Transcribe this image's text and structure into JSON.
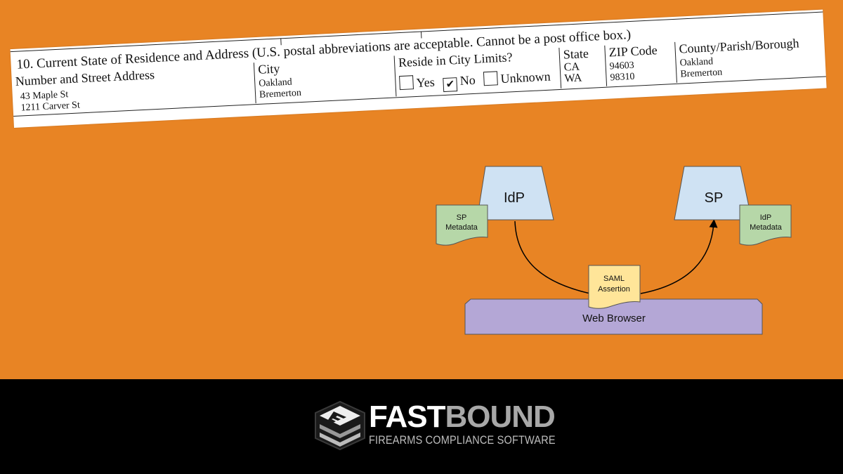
{
  "form": {
    "title": "10.  Current State of Residence and Address  (U.S. postal abbreviations are acceptable.  Cannot be a post office box.)",
    "columns": {
      "street": {
        "header": "Number and Street Address",
        "values": [
          "43 Maple St",
          "1211 Carver St"
        ]
      },
      "city": {
        "header": "City",
        "values": [
          "Oakland",
          "Bremerton"
        ]
      },
      "city_limits": {
        "header": "Reside in City Limits?",
        "options": [
          {
            "label": "Yes",
            "checked": false,
            "mark": ""
          },
          {
            "label": "No",
            "checked": true,
            "mark": "✔"
          },
          {
            "label": "Unknown",
            "checked": false,
            "mark": ""
          }
        ]
      },
      "state": {
        "header": "State",
        "values": [
          "CA",
          "WA"
        ]
      },
      "zip": {
        "header": "ZIP Code",
        "values": [
          "94603",
          "98310"
        ]
      },
      "county": {
        "header": "County/Parish/Borough",
        "values": [
          "Oakland",
          "Bremerton"
        ]
      }
    }
  },
  "diagram": {
    "idp": {
      "label": "IdP"
    },
    "sp": {
      "label": "SP"
    },
    "sp_metadata": {
      "line1": "SP",
      "line2": "Metadata"
    },
    "idp_metadata": {
      "line1": "IdP",
      "line2": "Metadata"
    },
    "saml_assertion": {
      "line1": "SAML",
      "line2": "Assertion"
    },
    "browser": {
      "label": "Web Browser"
    },
    "colors": {
      "server": "#cfe2f3",
      "metadata": "#b6d7a8",
      "assertion": "#ffe599",
      "browser": "#b4a7d6",
      "background": "#e88424"
    }
  },
  "footer": {
    "brand_part1": "FAST",
    "brand_part2": "BOUND",
    "tagline": "FIREARMS COMPLIANCE SOFTWARE"
  }
}
